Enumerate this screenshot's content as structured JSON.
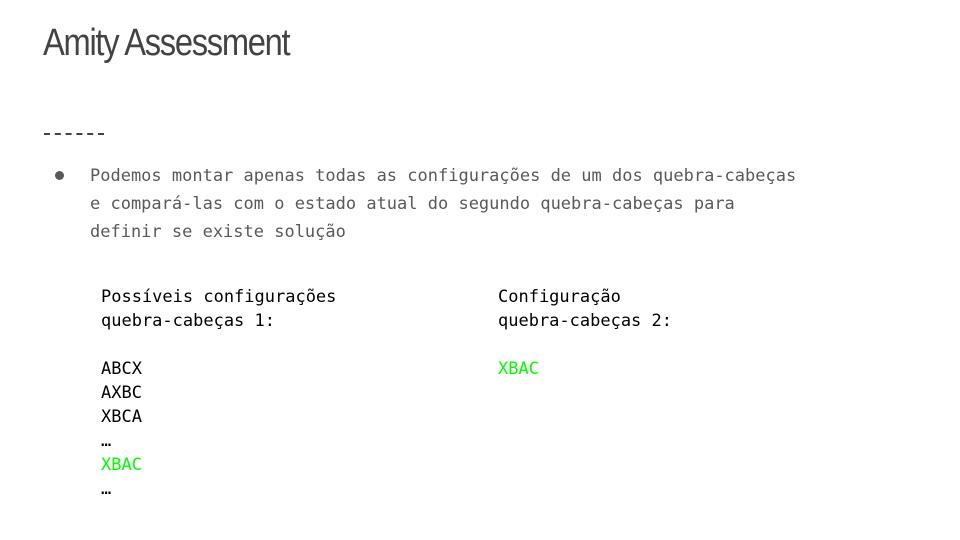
{
  "slide": {
    "title": "Amity Assessment",
    "bullet_lines": [
      "Podemos montar apenas todas as configurações de um dos quebra-cabeças",
      "e compará-las com o estado atual do segundo quebra-cabeças para",
      "definir se existe solução"
    ],
    "left_column": {
      "heading_lines": [
        "Possíveis configurações",
        "quebra-cabeças 1:"
      ],
      "items": [
        "ABCX",
        "AXBC",
        "XBCA",
        "…",
        "XBAC",
        "…"
      ],
      "highlighted_item": "XBAC"
    },
    "right_column": {
      "heading_lines": [
        "Configuração",
        "quebra-cabeças 2:"
      ],
      "items": [
        "XBAC"
      ]
    },
    "colors": {
      "title": "#434343",
      "body_text": "#595959",
      "highlight": "#00ff00"
    }
  }
}
